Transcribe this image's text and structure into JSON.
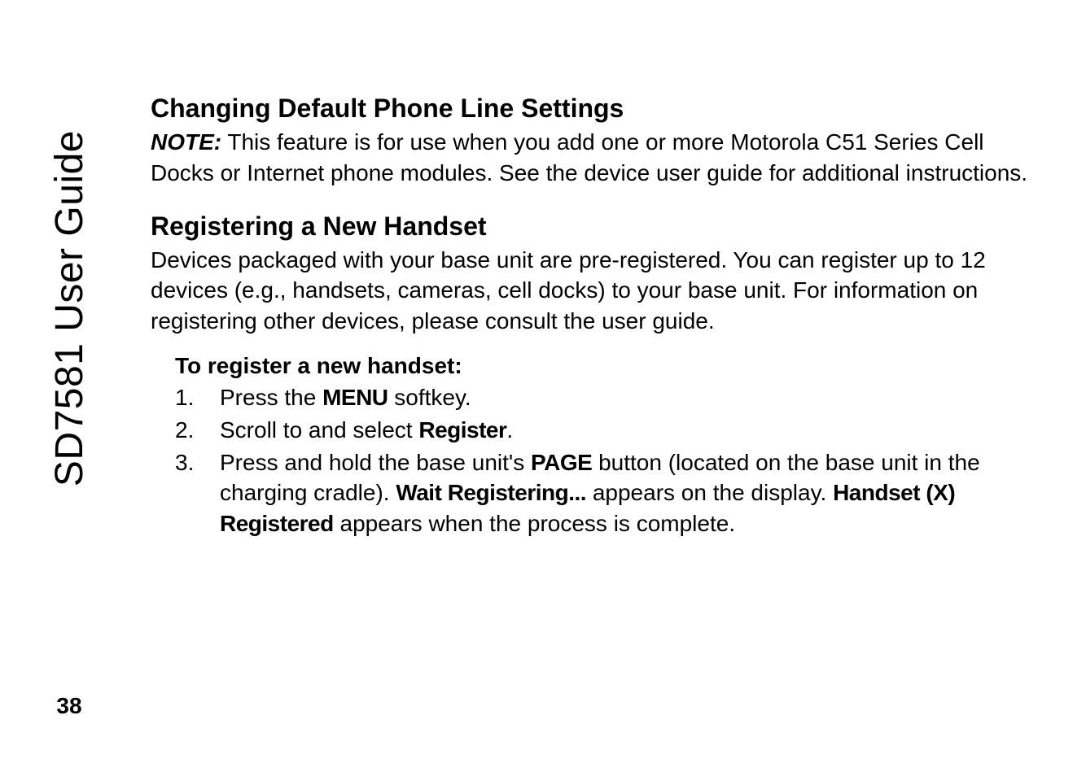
{
  "sidebar": {
    "title": "SD7581 User Guide",
    "page_number": "38"
  },
  "sections": {
    "changing": {
      "heading": "Changing Default Phone Line Settings",
      "note_label": "NOTE:",
      "note_body": "  This feature is for use when you add one or more Motorola C51 Series Cell Docks or Internet phone modules. See the device user guide for additional instructions."
    },
    "registering": {
      "heading": "Registering a New Handset",
      "intro": "Devices packaged with your base unit are pre-registered. You can register up to 12 devices (e.g., handsets, cameras, cell docks) to your base unit. For information on registering other devices, please consult the user guide.",
      "sub_heading": "To register a new handset:",
      "steps": {
        "s1_num": "1.",
        "s1_a": "Press the ",
        "s1_menu": "MENU",
        "s1_b": " softkey.",
        "s2_num": "2.",
        "s2_a": "Scroll to and select ",
        "s2_register": "Register",
        "s2_b": ".",
        "s3_num": "3.",
        "s3_a": "Press and hold the base unit's ",
        "s3_page": "PAGE",
        "s3_b": " button (located on the base unit in the charging cradle). ",
        "s3_wait": "Wait Registering...",
        "s3_c": " appears on the display. ",
        "s3_handset": "Handset (X) Registered",
        "s3_d": " appears when the process is complete."
      }
    }
  }
}
